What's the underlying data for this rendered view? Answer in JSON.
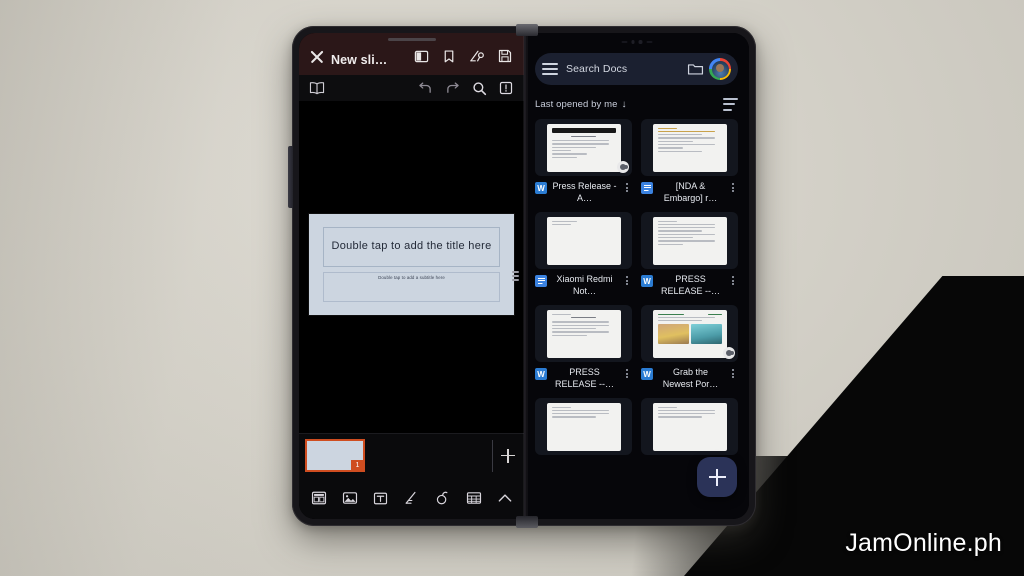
{
  "watermark": "JamOnline.ph",
  "left_screen": {
    "app": "slides-editor",
    "topbar": {
      "close_label": "close",
      "title": "New sli…",
      "icons": [
        "split-screen-icon",
        "bookmark-icon",
        "signature-pen-icon",
        "save-icon"
      ]
    },
    "subbar": {
      "icons": [
        "book-reading-icon",
        "undo-icon",
        "redo-icon",
        "search-icon",
        "info-icon"
      ]
    },
    "slide": {
      "title_placeholder": "Double tap to add the title here",
      "subtitle_placeholder": "Double tap to add a subtitle here"
    },
    "filmstrip": {
      "slide_number": "1",
      "add_slide_label": "+"
    },
    "bottombar": {
      "icons": [
        "slide-layout-icon",
        "image-icon",
        "text-box-icon",
        "draw-pen-icon",
        "shapes-icon",
        "table-icon",
        "chevron-up-icon"
      ]
    }
  },
  "right_screen": {
    "app": "google-docs",
    "search": {
      "placeholder": "Search Docs",
      "menu_icon": "hamburger-icon",
      "folder_icon": "folder-icon",
      "avatar_icon": "user-avatar"
    },
    "sort": {
      "label": "Last opened by me",
      "arrow": "↓",
      "view_icon": "list-view-icon"
    },
    "documents": [
      {
        "name": "Press Release - A…",
        "type": "word",
        "thumb": "red-banner"
      },
      {
        "name": "[NDA & Embargo] r…",
        "type": "gdoc",
        "thumb": "plain-gold"
      },
      {
        "name": "Xiaomi Redmi Not…",
        "type": "gdoc",
        "thumb": "sparse"
      },
      {
        "name": "PRESS RELEASE --…",
        "type": "word",
        "thumb": "plain"
      },
      {
        "name": "PRESS RELEASE --…",
        "type": "word",
        "thumb": "plain"
      },
      {
        "name": "Grab the Newest Por…",
        "type": "word",
        "thumb": "photos",
        "shared": true
      },
      {
        "name": "",
        "type": "none",
        "thumb": "partial"
      },
      {
        "name": "",
        "type": "none",
        "thumb": "partial"
      }
    ],
    "fab": {
      "label": "+",
      "icon": "plus-icon",
      "color": "#2b3358"
    }
  }
}
